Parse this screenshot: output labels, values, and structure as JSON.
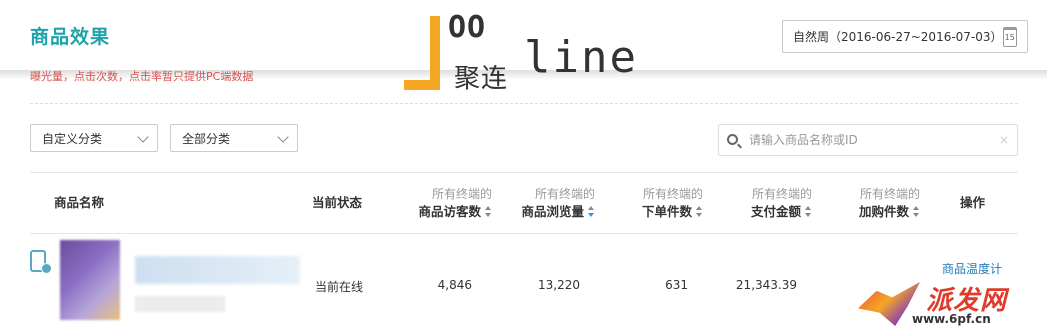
{
  "header": {
    "title": "商品效果",
    "date_range": "自然周（2016-06-27~2016-07-03）",
    "calendar_day": "15"
  },
  "note": "曝光量，点击次数，点击率暂只提供PC端数据",
  "filters": {
    "category": "自定义分类",
    "all_category": "全部分类",
    "search_placeholder": "请输入商品名称或ID",
    "search_clear": "×"
  },
  "table": {
    "columns": [
      {
        "sub": "",
        "label": "商品名称"
      },
      {
        "sub": "",
        "label": "当前状态"
      },
      {
        "sub": "所有终端的",
        "label": "商品访客数"
      },
      {
        "sub": "所有终端的",
        "label": "商品浏览量"
      },
      {
        "sub": "所有终端的",
        "label": "下单件数"
      },
      {
        "sub": "所有终端的",
        "label": "支付金额"
      },
      {
        "sub": "所有终端的",
        "label": "加购件数"
      },
      {
        "sub": "",
        "label": "操作"
      }
    ],
    "rows": [
      {
        "status": "当前在线",
        "visitors": "4,846",
        "pageviews": "13,220",
        "orders": "631",
        "payment": "21,343.39",
        "action": "商品温度计"
      }
    ]
  },
  "watermark": {
    "oo": "OO",
    "line": "line",
    "cn": "聚连"
  },
  "corner_logo": {
    "text": "派发网",
    "url": "www.6pf.cn"
  },
  "colors": {
    "title": "#1ea3a9",
    "note": "#d9534f",
    "link": "#1e7bb8",
    "watermark_accent": "#f5a623"
  }
}
